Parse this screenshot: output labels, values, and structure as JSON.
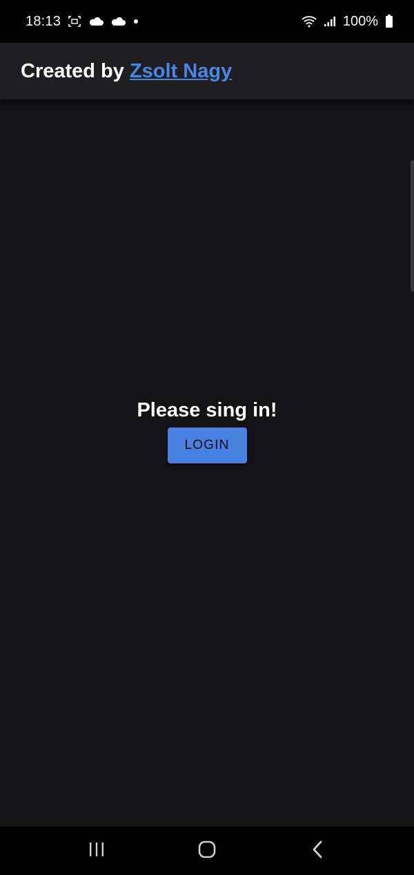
{
  "status_bar": {
    "time": "18:13",
    "battery": "100%",
    "icons": [
      "screenshot-icon",
      "cloud-icon",
      "cloud-icon",
      "dot-icon",
      "wifi-icon",
      "signal-icon",
      "battery-icon"
    ]
  },
  "header": {
    "prefix": "Created by ",
    "author_link": "Zsolt Nagy",
    "link_color": "#4a86e8"
  },
  "main": {
    "prompt": "Please sing in!",
    "login_button": "LOGIN",
    "button_color": "#4a80e0"
  },
  "nav_bar": {
    "buttons": [
      "recent-apps-icon",
      "home-icon",
      "back-icon"
    ]
  }
}
